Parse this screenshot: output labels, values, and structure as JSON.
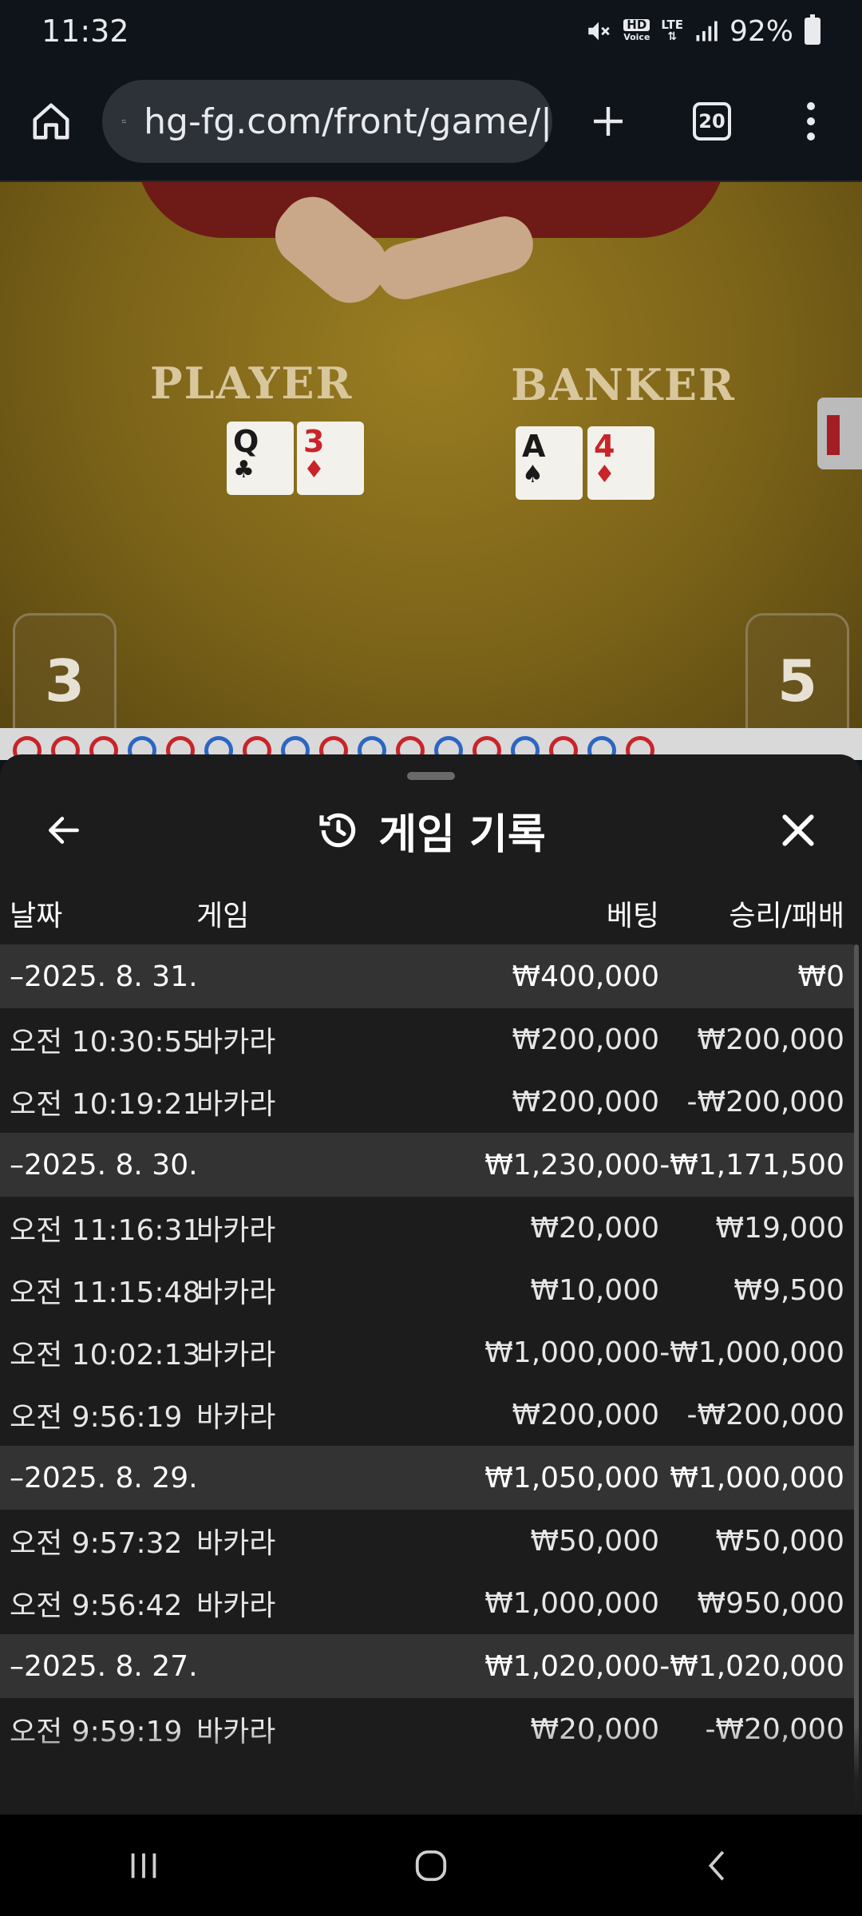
{
  "status": {
    "time": "11:32",
    "hd_label": "HD",
    "voice_label": "Voice",
    "lte_label": "LTE",
    "battery": "92%"
  },
  "browser": {
    "url": "hg-fg.com/front/game/|",
    "tab_count": "20"
  },
  "game": {
    "player_label": "PLAYER",
    "banker_label": "BANKER",
    "player_score": "3",
    "banker_score": "5",
    "player_cards": [
      {
        "rank": "Q",
        "suit": "♣",
        "color": "black"
      },
      {
        "rank": "3",
        "suit": "♦",
        "color": "red"
      }
    ],
    "banker_cards": [
      {
        "rank": "A",
        "suit": "♠",
        "color": "black"
      },
      {
        "rank": "4",
        "suit": "♦",
        "color": "red"
      }
    ]
  },
  "sheet": {
    "title": "게임 기록",
    "columns": {
      "date": "날짜",
      "game": "게임",
      "bet": "베팅",
      "win": "승리/패배"
    },
    "rows": [
      {
        "type": "group",
        "date": "–2025. 8. 31.",
        "game": "",
        "bet": "₩400,000",
        "win": "₩0"
      },
      {
        "type": "item",
        "date": "오전 10:30:55",
        "game": "바카라",
        "bet": "₩200,000",
        "win": "₩200,000"
      },
      {
        "type": "item",
        "date": "오전 10:19:21",
        "game": "바카라",
        "bet": "₩200,000",
        "win": "-₩200,000"
      },
      {
        "type": "group",
        "date": "–2025. 8. 30.",
        "game": "",
        "bet": "₩1,230,000",
        "win": "-₩1,171,500"
      },
      {
        "type": "item",
        "date": "오전 11:16:31",
        "game": "바카라",
        "bet": "₩20,000",
        "win": "₩19,000"
      },
      {
        "type": "item",
        "date": "오전 11:15:48",
        "game": "바카라",
        "bet": "₩10,000",
        "win": "₩9,500"
      },
      {
        "type": "item",
        "date": "오전 10:02:13",
        "game": "바카라",
        "bet": "₩1,000,000",
        "win": "-₩1,000,000"
      },
      {
        "type": "item",
        "date": "오전 9:56:19",
        "game": "바카라",
        "bet": "₩200,000",
        "win": "-₩200,000"
      },
      {
        "type": "group",
        "date": "–2025. 8. 29.",
        "game": "",
        "bet": "₩1,050,000",
        "win": "₩1,000,000"
      },
      {
        "type": "item",
        "date": "오전 9:57:32",
        "game": "바카라",
        "bet": "₩50,000",
        "win": "₩50,000"
      },
      {
        "type": "item",
        "date": "오전 9:56:42",
        "game": "바카라",
        "bet": "₩1,000,000",
        "win": "₩950,000"
      },
      {
        "type": "group",
        "date": "–2025. 8. 27.",
        "game": "",
        "bet": "₩1,020,000",
        "win": "-₩1,020,000"
      },
      {
        "type": "item",
        "date": "오전 9:59:19",
        "game": "바카라",
        "bet": "₩20,000",
        "win": "-₩20,000"
      }
    ]
  }
}
